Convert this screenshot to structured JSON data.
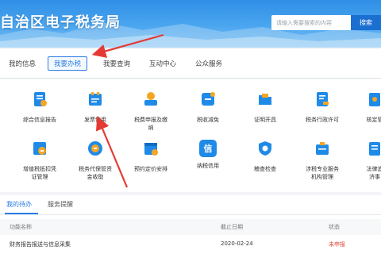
{
  "header": {
    "title": "自治区电子税务局",
    "search_placeholder": "请输入需要搜索的内容",
    "search_button": "搜索"
  },
  "nav": {
    "tabs": [
      "我的信息",
      "我要办税",
      "我要查询",
      "互动中心",
      "公众服务"
    ],
    "active_index": 1
  },
  "services": {
    "row1": [
      {
        "label": "综合信息报告",
        "icon": "report-icon"
      },
      {
        "label": "发票使用",
        "icon": "invoice-icon"
      },
      {
        "label": "税费申报及缴\n纳",
        "icon": "tax-declare-icon"
      },
      {
        "label": "税收减免",
        "icon": "tax-relief-icon"
      },
      {
        "label": "证明开具",
        "icon": "certificate-icon"
      },
      {
        "label": "税务行政许可",
        "icon": "license-icon"
      },
      {
        "label": "核定管",
        "icon": "verify-icon"
      }
    ],
    "row2": [
      {
        "label": "增值税抵扣凭\n证管理",
        "icon": "vat-voucher-icon"
      },
      {
        "label": "税务代保管资\n金收取",
        "icon": "funds-custody-icon"
      },
      {
        "label": "预约定价安排",
        "icon": "pricing-icon"
      },
      {
        "label": "纳税信用",
        "icon": "credit-icon",
        "glyph": "信"
      },
      {
        "label": "稽查检查",
        "icon": "inspection-icon"
      },
      {
        "label": "涉税专业服务\n机构管理",
        "icon": "agency-icon"
      },
      {
        "label": "法律追\n济事",
        "icon": "legal-icon"
      }
    ]
  },
  "tasks": {
    "tabs": [
      "我的待办",
      "服务提醒"
    ],
    "columns": [
      "功能名称",
      "截止日期",
      "状态"
    ],
    "rows": [
      {
        "name": "财务报告报送与信息采集",
        "deadline": "2020-02-24",
        "status": "未申报"
      }
    ]
  },
  "colors": {
    "accent": "#2b7de1",
    "banner": "#3c9aea",
    "icon_blue": "#1f8ae8",
    "icon_orange": "#f5a623",
    "status_red": "#e0483a",
    "annotation_red": "#e53935"
  }
}
